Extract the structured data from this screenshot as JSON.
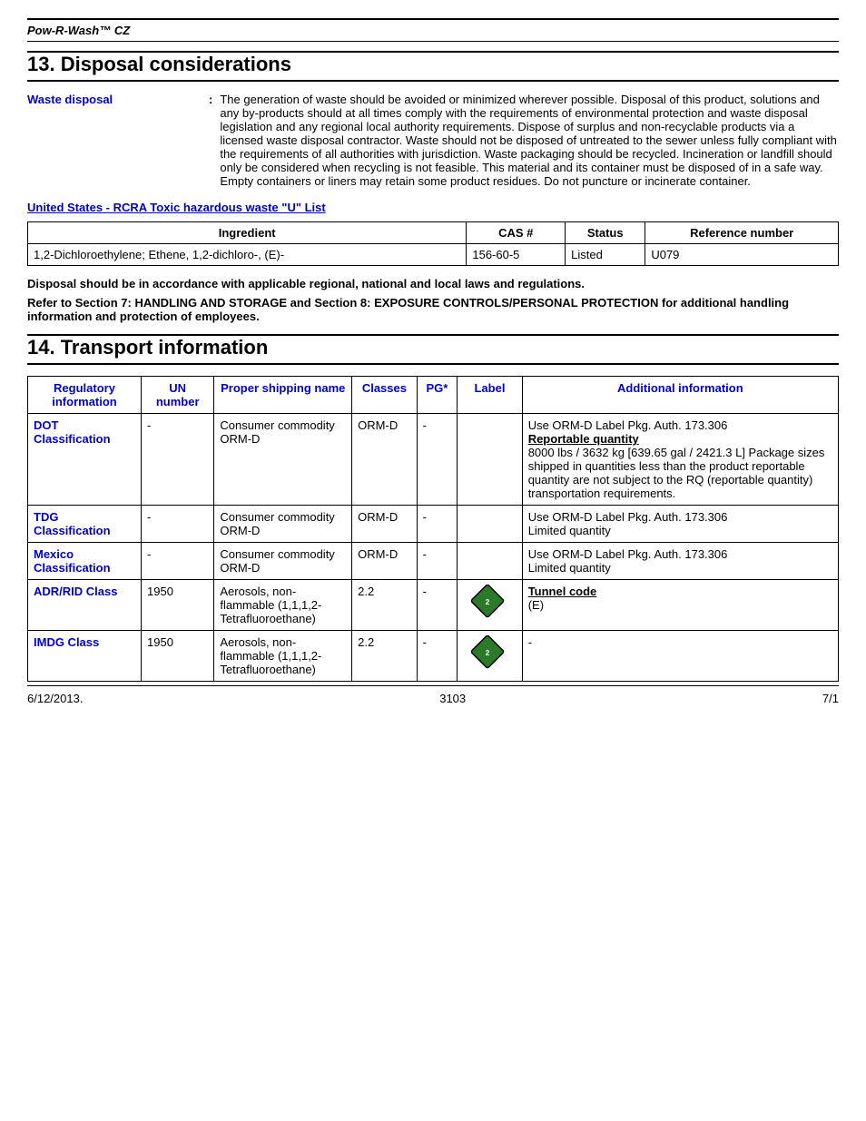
{
  "header": {
    "product_name": "Pow-R-Wash™ CZ"
  },
  "section13": {
    "title": "13. Disposal considerations",
    "waste_disposal_label": "Waste disposal",
    "colon": ":",
    "waste_disposal_text": "The generation of waste should be avoided or minimized wherever possible.  Disposal of this product, solutions and any by-products should at all times comply with the requirements of environmental protection and waste disposal legislation and any regional local authority requirements.  Dispose of surplus and non-recyclable products via a licensed waste disposal contractor.  Waste should not be disposed of untreated to the sewer unless fully compliant with the requirements of all authorities with jurisdiction.  Waste packaging should be recycled.  Incineration or landfill should only be considered when recycling is not feasible.  This material and its container must be disposed of in a safe way.  Empty containers or liners may retain some product residues.  Do not puncture or incinerate container.",
    "rcra_link": "United States - RCRA Toxic hazardous waste \"U\" List",
    "table_headers": [
      "Ingredient",
      "CAS #",
      "Status",
      "Reference number"
    ],
    "table_rows": [
      {
        "ingredient": "1,2-Dichloroethylene; Ethene, 1,2-dichloro-, (E)-",
        "cas": "156-60-5",
        "status": "Listed",
        "reference": "U079"
      }
    ],
    "note1": "Disposal should be in accordance with applicable regional, national and local laws and regulations.",
    "note2": "Refer to Section 7: HANDLING AND STORAGE and Section 8: EXPOSURE CONTROLS/PERSONAL PROTECTION for additional handling information and protection of employees."
  },
  "section14": {
    "title": "14. Transport information",
    "table_headers": {
      "regulatory": "Regulatory information",
      "un_number": "UN number",
      "proper_shipping": "Proper shipping name",
      "classes": "Classes",
      "pg": "PG*",
      "label": "Label",
      "additional": "Additional information"
    },
    "rows": [
      {
        "regulatory": "DOT Classification",
        "un_number": "-",
        "proper_shipping": "Consumer commodity ORM-D",
        "classes": "ORM-D",
        "pg": "-",
        "label": "",
        "additional": "Use ORM-D Label Pkg. Auth. 173.306\nReportable quantity\n8000 lbs / 3632 kg [639.65 gal / 2421.3 L] Package sizes shipped in quantities less than the product reportable quantity are not subject to the RQ (reportable quantity) transportation requirements.",
        "has_reportable": true,
        "has_diamond": false
      },
      {
        "regulatory": "TDG Classification",
        "un_number": "-",
        "proper_shipping": "Consumer commodity ORM-D",
        "classes": "ORM-D",
        "pg": "-",
        "label": "",
        "additional": "Use ORM-D Label Pkg. Auth. 173.306\nLimited quantity",
        "has_reportable": false,
        "has_diamond": false
      },
      {
        "regulatory": "Mexico Classification",
        "un_number": "-",
        "proper_shipping": "Consumer commodity ORM-D",
        "classes": "ORM-D",
        "pg": "-",
        "label": "",
        "additional": "Use ORM-D Label Pkg. Auth. 173.306\nLimited quantity",
        "has_reportable": false,
        "has_diamond": false
      },
      {
        "regulatory": "ADR/RID Class",
        "un_number": "1950",
        "proper_shipping": "Aerosols, non-flammable (1,1,1,2-Tetrafluoroethane)",
        "classes": "2.2",
        "pg": "-",
        "label": "diamond",
        "additional": "Tunnel code\n(E)",
        "has_tunnel": true,
        "has_diamond": true
      },
      {
        "regulatory": "IMDG Class",
        "un_number": "1950",
        "proper_shipping": "Aerosols, non-flammable (1,1,1,2-Tetrafluoroethane)",
        "classes": "2.2",
        "pg": "-",
        "label": "diamond",
        "additional": "-",
        "has_tunnel": false,
        "has_diamond": true
      }
    ]
  },
  "footer": {
    "date": "6/12/2013.",
    "page": "3103",
    "page_num": "7/1"
  }
}
